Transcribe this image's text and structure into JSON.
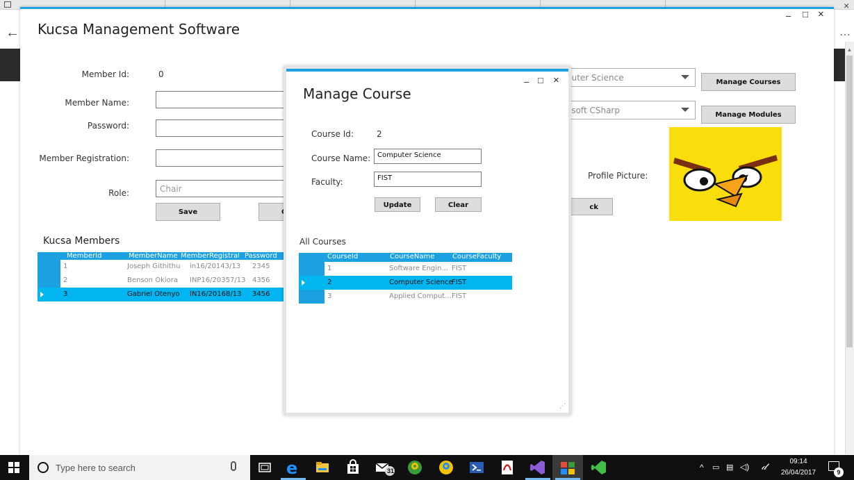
{
  "app": {
    "title": "Kucsa Management Software",
    "window_controls": {
      "minimize": "–",
      "maximize": "□",
      "close": "×"
    }
  },
  "browser": {
    "back_icon": "←",
    "more_icon": "…",
    "close_icon": "×"
  },
  "form": {
    "member_id_label": "Member Id:",
    "member_id_value": "0",
    "member_name_label": "Member Name:",
    "password_label": "Password:",
    "registration_label": "Member Registration:",
    "role_label": "Role:",
    "role_placeholder": "Chair",
    "save_button": "Save",
    "clear_button_partial": "Cl",
    "profile_picture_label": "Profile Picture:",
    "pick_picture_button": "ck Picture"
  },
  "course_combo": {
    "value": "puter Science"
  },
  "module_combo": {
    "value": "osoft CSharp"
  },
  "manage_courses_button": "Manage Courses",
  "manage_modules_button": "Manage Modules",
  "members": {
    "title": "Kucsa Members",
    "columns": [
      "MemberId",
      "MemberName",
      "MemberRegistrati",
      "Password"
    ],
    "rows": [
      {
        "id": "1",
        "name": "Joseph Githithu",
        "reg": "in16/20143/13",
        "pwd": "2345",
        "selected": false
      },
      {
        "id": "2",
        "name": "Benson Okiora",
        "reg": "INP16/20357/13",
        "pwd": "4356",
        "selected": false
      },
      {
        "id": "3",
        "name": "Gabriel Otenyo",
        "reg": "IN16/20168/13",
        "pwd": "3456",
        "selected": true
      }
    ]
  },
  "dialog": {
    "title": "Manage Course",
    "course_id_label": "Course Id:",
    "course_id_value": "2",
    "course_name_label": "Course Name:",
    "course_name_value": "Computer Science",
    "faculty_label": "Faculty:",
    "faculty_value": "FIST",
    "update_button": "Update",
    "clear_button": "Clear",
    "all_courses_label": "All Courses",
    "columns": [
      "CourseId",
      "CourseName",
      "CourseFaculty"
    ],
    "rows": [
      {
        "id": "1",
        "name": "Software Engin...",
        "faculty": "FIST",
        "selected": false
      },
      {
        "id": "2",
        "name": "Computer Science",
        "faculty": "FIST",
        "selected": true
      },
      {
        "id": "3",
        "name": "Applied Comput...",
        "faculty": "FIST",
        "selected": false
      }
    ]
  },
  "taskbar": {
    "search_placeholder": "Type here to search",
    "mail_badge": "31",
    "time": "09:14",
    "date": "26/04/2017",
    "notification_count": "9",
    "tray_icons": [
      "chevron-up-icon",
      "language-icon",
      "network-icon",
      "volume-icon",
      "pen-icon"
    ]
  },
  "colors": {
    "accent": "#1ba1e2",
    "selected_row": "#00b5f0",
    "picture_bg": "#f9de0b",
    "taskbar": "#101010"
  }
}
